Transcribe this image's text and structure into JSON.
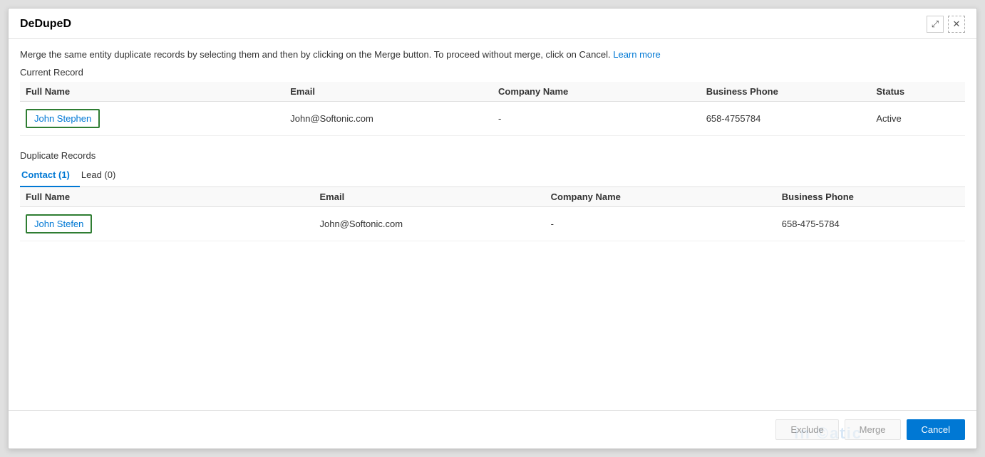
{
  "dialog": {
    "title": "DeDupeD",
    "info_text": "Merge the same entity duplicate records by selecting them and then by clicking on the Merge button. To proceed without merge, click on Cancel.",
    "learn_more_label": "Learn more",
    "current_record_label": "Current Record",
    "duplicate_records_label": "Duplicate Records"
  },
  "current_record": {
    "columns": {
      "full_name": "Full Name",
      "email": "Email",
      "company_name": "Company Name",
      "business_phone": "Business Phone",
      "status": "Status"
    },
    "row": {
      "full_name": "John Stephen",
      "email": "John@Softonic.com",
      "company_name": "-",
      "business_phone": "658-4755784",
      "status": "Active"
    }
  },
  "tabs": [
    {
      "label": "Contact (1)",
      "active": true
    },
    {
      "label": "Lead (0)",
      "active": false
    }
  ],
  "duplicate_records": {
    "columns": {
      "full_name": "Full Name",
      "email": "Email",
      "company_name": "Company Name",
      "business_phone": "Business Phone"
    },
    "rows": [
      {
        "full_name": "John Stefen",
        "email": "John@Softonic.com",
        "company_name": "-",
        "business_phone": "658-475-5784"
      }
    ]
  },
  "footer": {
    "exclude_label": "Exclude",
    "merge_label": "Merge",
    "cancel_label": "Cancel"
  },
  "controls": {
    "expand_icon": "⤢",
    "close_icon": "✕"
  }
}
